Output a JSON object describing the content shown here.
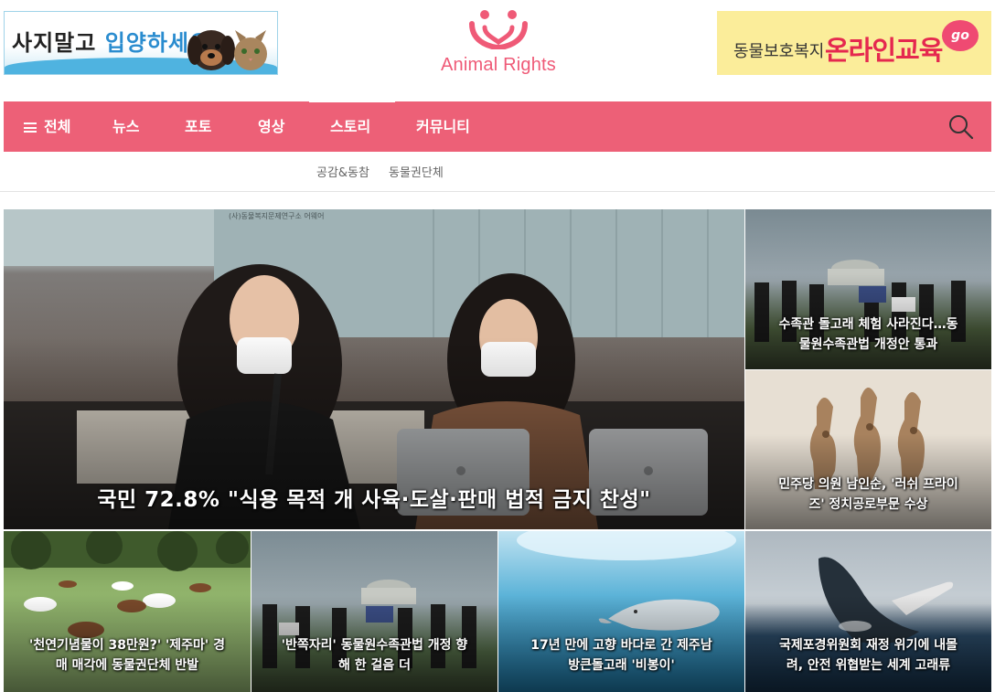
{
  "header": {
    "left_banner": {
      "text_part1": "사지말고 ",
      "text_part2": "입양하세요"
    },
    "logo": {
      "name": "Animal Rights"
    },
    "right_banner": {
      "text_part1": "동물보호복지 ",
      "text_part2": "온라인교육",
      "bubble": "go"
    }
  },
  "nav": {
    "items": [
      {
        "label": "전체"
      },
      {
        "label": "뉴스"
      },
      {
        "label": "포토"
      },
      {
        "label": "영상"
      },
      {
        "label": "스토리"
      },
      {
        "label": "커뮤니티"
      }
    ],
    "active_index": 4,
    "search_icon": "search-icon"
  },
  "subnav": {
    "items": [
      "공감&동참",
      "동물권단체"
    ]
  },
  "featured": {
    "title": "국민 72.8% \"식용 목적 개 사육·도살·판매 법적 금지 찬성\"",
    "backdrop_text": "(사)동물복지문제연구소 어웨어"
  },
  "side_cards": [
    {
      "title_line1": "수족관 돌고래 체험 사라진다…동",
      "title_line2": "물원수족관법 개정안 통과"
    },
    {
      "title_line1": "민주당 의원 남인순, '러쉬 프라이",
      "title_line2": "즈' 정치공로부문 수상"
    }
  ],
  "bottom_cards": [
    {
      "title_line1": "'천연기념물이 38만원?' '제주마' 경",
      "title_line2": "매 매각에 동물권단체 반발"
    },
    {
      "title_line1": "'반쪽자리' 동물원수족관법 개정 향",
      "title_line2": "해 한 걸음 더"
    },
    {
      "title_line1": "17년 만에 고향 바다로 간 제주남",
      "title_line2": "방큰돌고래 '비봉이'"
    },
    {
      "title_line1": "국제포경위원회 재정 위기에 내몰",
      "title_line2": "려, 안전 위협받는 세계 고래류"
    }
  ],
  "colors": {
    "accent": "#ed6077",
    "logo": "#ef5a77"
  }
}
